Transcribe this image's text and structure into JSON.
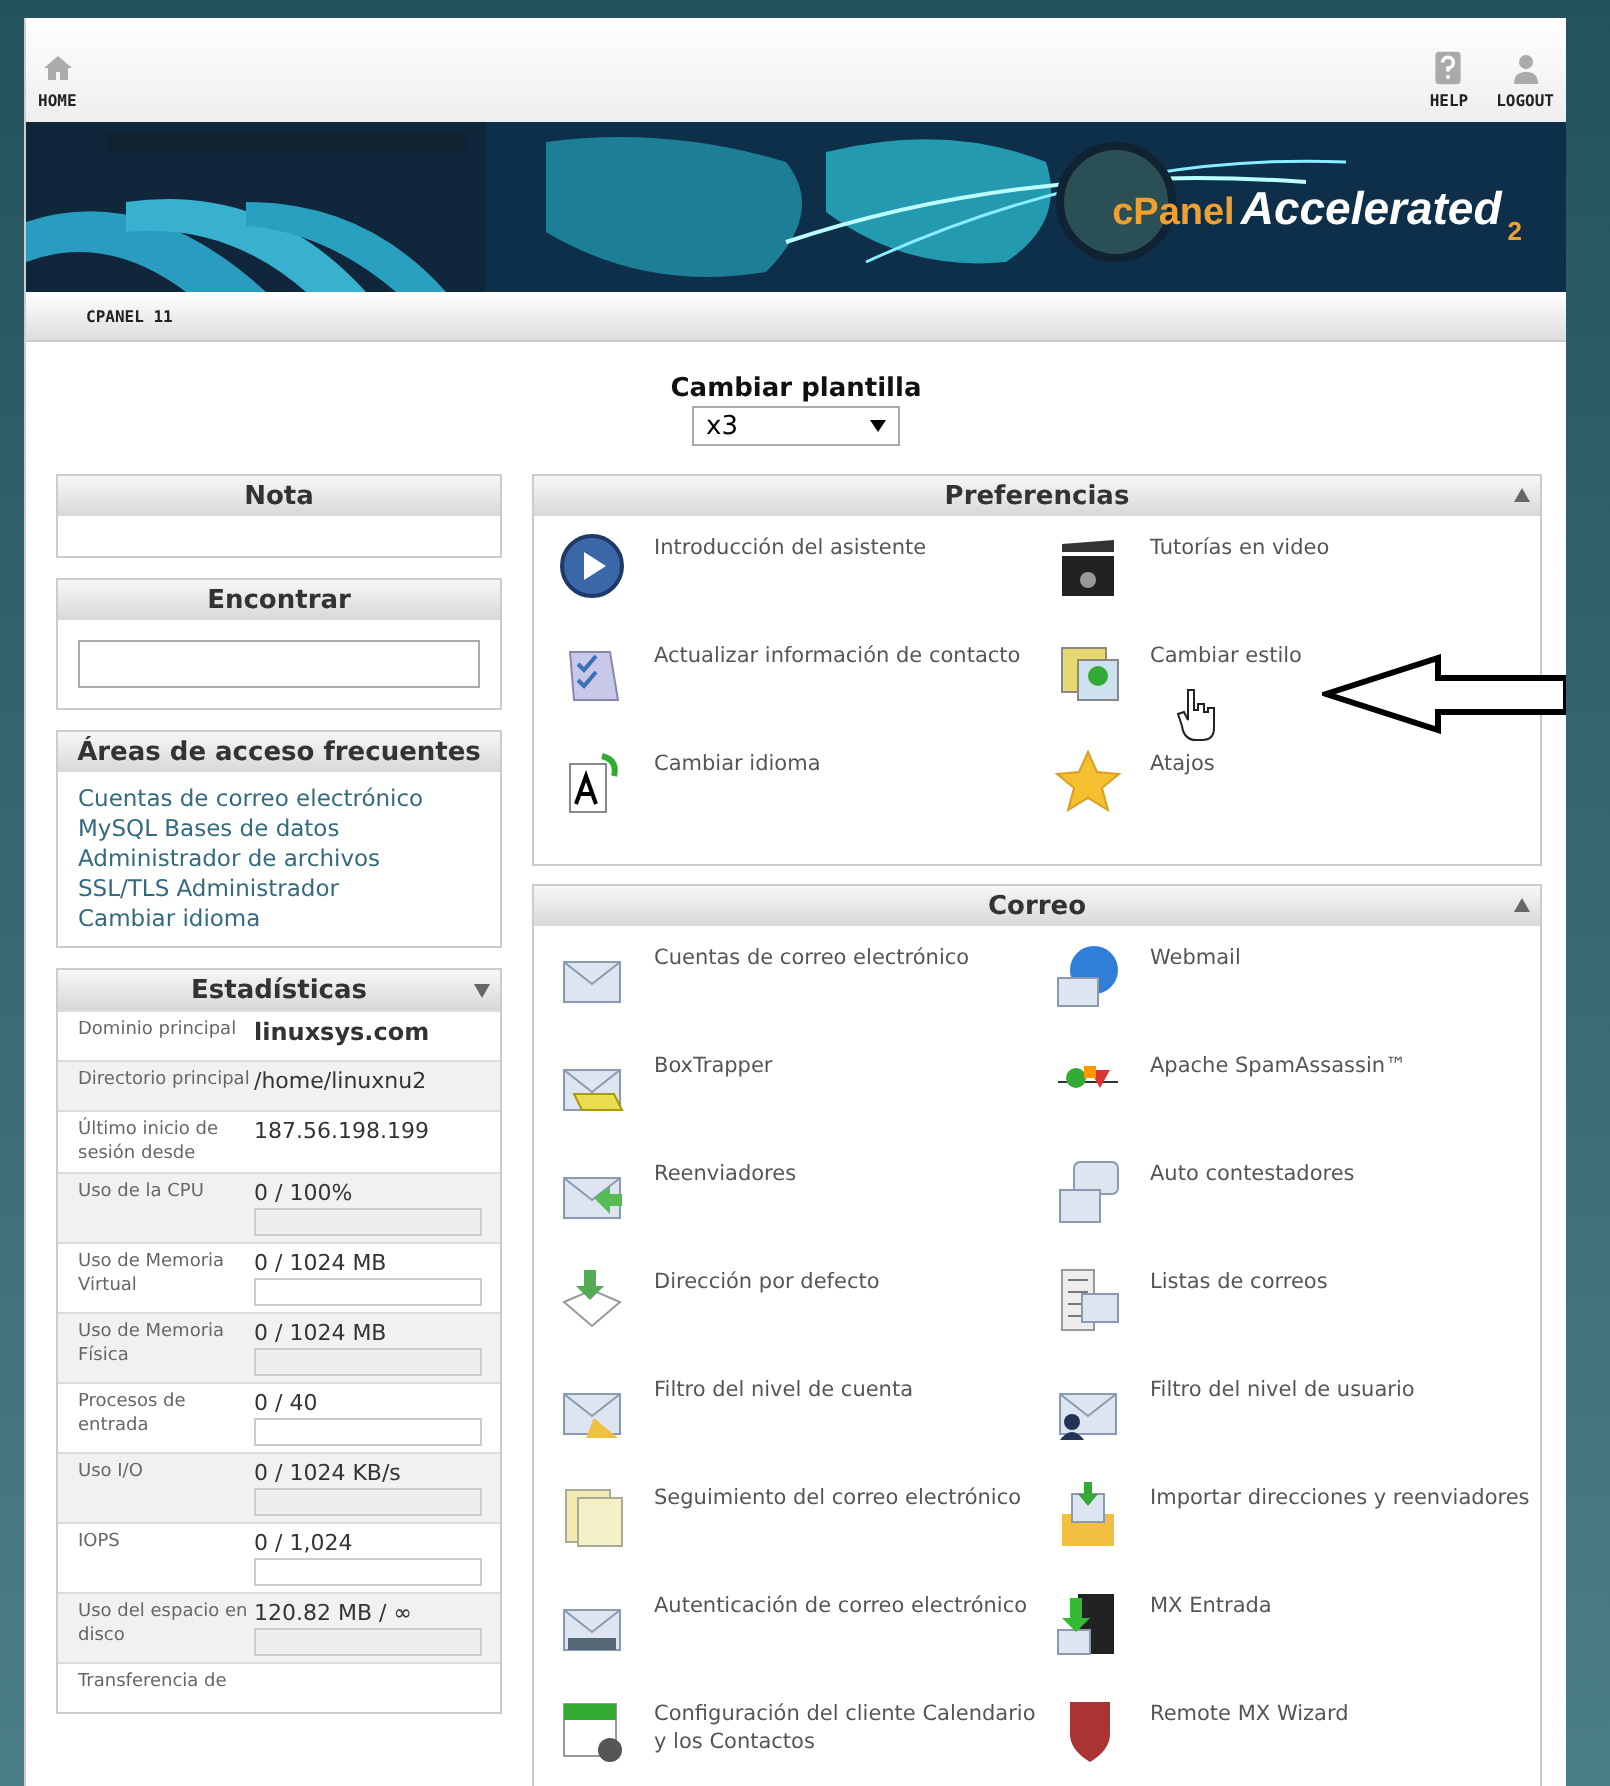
{
  "top_bar": {
    "home": "HOME",
    "help": "HELP",
    "logout": "LOGOUT"
  },
  "banner": {
    "kind": "picture",
    "logo_brand": "cPanel",
    "logo_product": "Accelerated",
    "logo_version": "2"
  },
  "breadcrumb": "CPANEL 11",
  "template": {
    "label": "Cambiar plantilla",
    "value": "x3"
  },
  "sidebar": {
    "note": {
      "title": "Nota"
    },
    "find": {
      "title": "Encontrar"
    },
    "frequent": {
      "title": "Áreas de acceso frecuentes",
      "links": [
        "Cuentas de correo electrónico",
        "MySQL Bases de datos",
        "Administrador de archivos",
        "SSL/TLS Administrador",
        "Cambiar idioma"
      ]
    },
    "stats": {
      "title": "Estadísticas",
      "expanded": true,
      "rows": [
        {
          "label": "Dominio principal",
          "value": "linuxsys.com",
          "kind": "bold"
        },
        {
          "label": "Directorio principal",
          "value": "/home/linuxnu2",
          "kind": "text"
        },
        {
          "label": "Último inicio de sesión desde",
          "value": "187.56.198.199",
          "kind": "text"
        },
        {
          "label": "Uso de la CPU",
          "value": "0 / 100%",
          "kind": "bar",
          "level": 0
        },
        {
          "label": "Uso de Memoria Virtual",
          "value": "0 / 1024 MB",
          "kind": "bar",
          "level": 0
        },
        {
          "label": "Uso de Memoria Física",
          "value": "0 / 1024 MB",
          "kind": "bar",
          "level": 0
        },
        {
          "label": "Procesos de entrada",
          "value": "0 / 40",
          "kind": "bar",
          "level": 0
        },
        {
          "label": "Uso I/O",
          "value": "0 / 1024 KB/s",
          "kind": "bar",
          "level": 0
        },
        {
          "label": "IOPS",
          "value": "0 / 1,024",
          "kind": "bar",
          "level": 0
        },
        {
          "label": "Uso del espacio en disco",
          "value": "120.82 MB / ∞",
          "kind": "bar",
          "level": 0
        },
        {
          "label": "Transferencia de",
          "kind": "cut"
        }
      ]
    }
  },
  "sections": [
    {
      "title": "Preferencias",
      "expanded": true,
      "items": [
        "Introducción del asistente",
        "Tutorías en video",
        "Actualizar información de contacto",
        "Cambiar estilo",
        "Cambiar idioma",
        "Atajos"
      ]
    },
    {
      "title": "Correo",
      "expanded": true,
      "items": [
        "Cuentas de correo electrónico",
        "Webmail",
        "BoxTrapper",
        "Apache SpamAssassin™",
        "Reenviadores",
        "Auto contestadores",
        "Dirección por defecto",
        "Listas de correos",
        "Filtro del nivel de cuenta",
        "Filtro del nivel de usuario",
        "Seguimiento del correo electrónico",
        "Importar direcciones y reenviadores",
        "Autenticación de correo electrónico",
        "MX Entrada",
        "Configuración del cliente Calendario y los Contactos",
        "Remote MX Wizard"
      ]
    }
  ]
}
